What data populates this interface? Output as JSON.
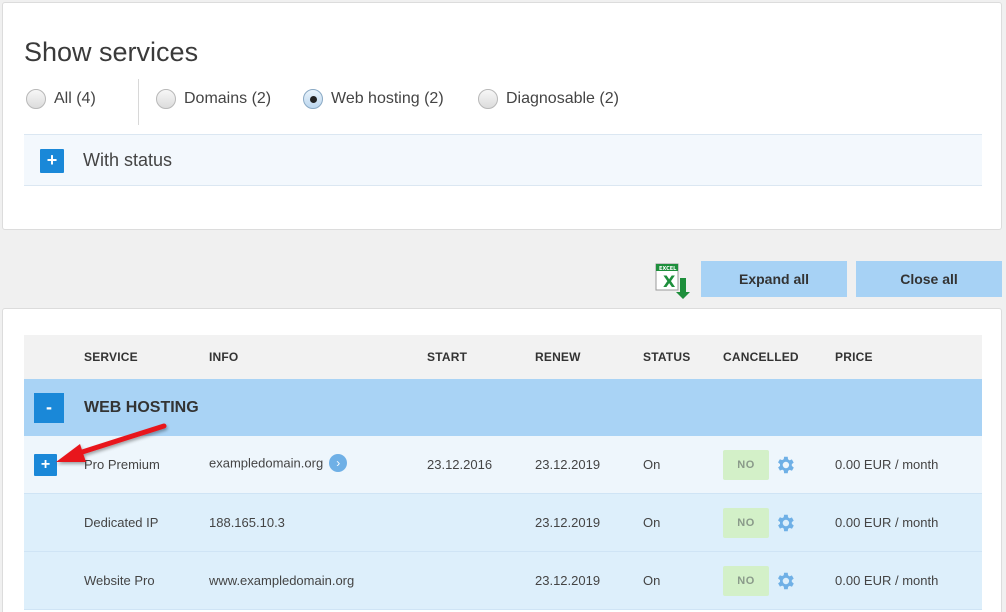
{
  "filter": {
    "title": "Show services",
    "options": [
      {
        "label": "All (4)",
        "checked": false
      },
      {
        "label": "Domains (2)",
        "checked": false
      },
      {
        "label": "Web hosting (2)",
        "checked": true
      },
      {
        "label": "Diagnosable (2)",
        "checked": false
      }
    ],
    "status_toggle": "+",
    "status_label": "With status"
  },
  "toolbar": {
    "excel_icon": "excel-export-icon",
    "expand_all": "Expand all",
    "close_all": "Close all"
  },
  "table": {
    "headers": {
      "service": "SERVICE",
      "info": "INFO",
      "start": "START",
      "renew": "RENEW",
      "status": "STATUS",
      "cancelled": "CANCELLED",
      "price": "PRICE"
    },
    "group": {
      "toggle": "-",
      "label": "WEB HOSTING"
    },
    "rows": [
      {
        "toggle": "+",
        "service": "Pro Premium",
        "info": "exampledomain.org",
        "start": "23.12.2016",
        "renew": "23.12.2019",
        "status": "On",
        "cancelled": "NO",
        "price": "0.00 EUR / month"
      },
      {
        "service": "Dedicated IP",
        "info": "188.165.10.3",
        "start": "",
        "renew": "23.12.2019",
        "status": "On",
        "cancelled": "NO",
        "price": "0.00 EUR / month"
      },
      {
        "service": "Website Pro",
        "info": "www.exampledomain.org",
        "start": "",
        "renew": "23.12.2019",
        "status": "On",
        "cancelled": "NO",
        "price": "0.00 EUR / month"
      }
    ]
  },
  "colors": {
    "accent": "#1a88d8",
    "group_bg": "#a9d3f5",
    "button_bg": "#a7d2f5",
    "badge_bg": "#d3f0c8",
    "annotation_arrow": "#e8191d"
  }
}
